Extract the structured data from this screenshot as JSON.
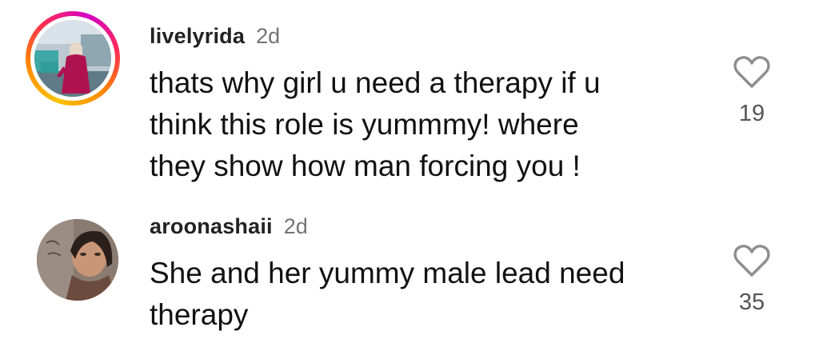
{
  "comments": [
    {
      "username": "livelyrida",
      "time": "2d",
      "lines": [
        "thats why girl u need a therapy if u",
        "think this role is yummmy! where",
        "they show how man forcing you !"
      ],
      "likes": "19",
      "has_story_ring": true,
      "avatar_icon": "profile-photo"
    },
    {
      "username": "aroonashaii",
      "time": "2d",
      "lines": [
        "She and her yummy male lead need",
        "therapy"
      ],
      "likes": "35",
      "has_story_ring": false,
      "avatar_icon": "profile-photo"
    }
  ],
  "icons": {
    "like": "heart-icon"
  },
  "colors": {
    "username": "#222222",
    "timestamp": "#737373",
    "like_count": "#555555",
    "story_ring": [
      "#f9c400",
      "#ff8a00",
      "#ff2d55",
      "#d300c5"
    ]
  }
}
